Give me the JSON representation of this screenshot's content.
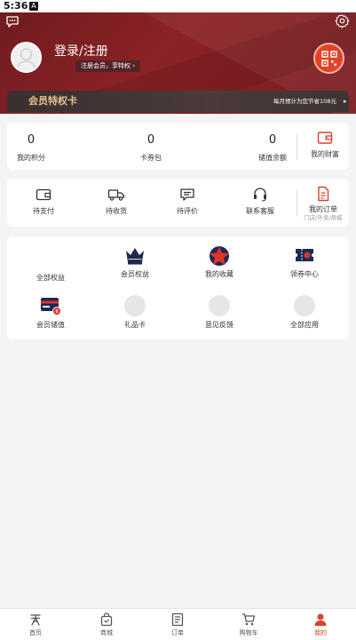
{
  "status_bar": {
    "time": "5:36",
    "notification_badge": "A"
  },
  "header": {
    "login_title": "登录/注册",
    "member_pill": "注册会员，享特权",
    "pill_arrow": "›",
    "icons": {
      "chat": "chat-bubble-icon",
      "settings": "gear-icon",
      "qr": "qr-code-icon"
    },
    "colors": {
      "primary": "#7a1d21",
      "accent": "#e04327",
      "gold": "#e3c390"
    }
  },
  "vip": {
    "title": "会员特权卡",
    "subtitle": "每月预计为您节省108元",
    "arrow": "▸"
  },
  "assets": {
    "items": [
      {
        "value": "0",
        "label": "我的积分"
      },
      {
        "value": "0",
        "label": "卡券包"
      },
      {
        "value": "0",
        "label": "储值余额"
      }
    ],
    "wallet_label": "我的财富"
  },
  "orders": {
    "items": [
      {
        "label": "待支付",
        "icon": "wallet-icon"
      },
      {
        "label": "待收货",
        "icon": "truck-icon"
      },
      {
        "label": "待评价",
        "icon": "comment-icon"
      },
      {
        "label": "联系客服",
        "icon": "headset-icon"
      }
    ],
    "my_orders": {
      "label": "我的订单",
      "sub": "门店/外卖/商城"
    }
  },
  "services": {
    "items": [
      {
        "label": "全部权益",
        "icon": "blank"
      },
      {
        "label": "会员权益",
        "icon": "crown-icon"
      },
      {
        "label": "我的收藏",
        "icon": "star-icon"
      },
      {
        "label": "领券中心",
        "icon": "ticket-icon"
      },
      {
        "label": "会员储值",
        "icon": "card-icon"
      },
      {
        "label": "礼品卡",
        "icon": "placeholder-icon"
      },
      {
        "label": "意见反馈",
        "icon": "placeholder-icon"
      },
      {
        "label": "全部应用",
        "icon": "placeholder-icon"
      }
    ]
  },
  "tabbar": {
    "active_color": "#d6432a",
    "tabs": [
      {
        "label": "首页",
        "icon": "home-icon"
      },
      {
        "label": "商城",
        "icon": "bag-icon"
      },
      {
        "label": "订单",
        "icon": "list-icon"
      },
      {
        "label": "购物车",
        "icon": "cart-icon"
      },
      {
        "label": "我的",
        "icon": "user-icon"
      }
    ]
  }
}
